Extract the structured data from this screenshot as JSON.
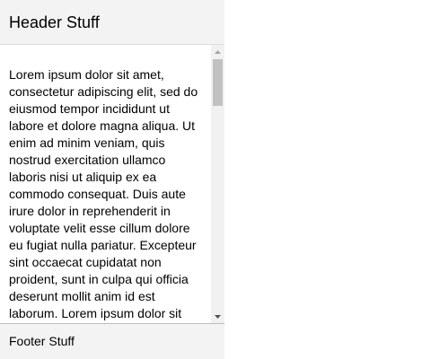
{
  "header": {
    "title": "Header Stuff"
  },
  "content": {
    "text": "Lorem ipsum dolor sit amet, consectetur adipiscing elit, sed do eiusmod tempor incididunt ut labore et dolore magna aliqua. Ut enim ad minim veniam, quis nostrud exercitation ullamco laboris nisi ut aliquip ex ea commodo consequat. Duis aute irure dolor in reprehenderit in voluptate velit esse cillum dolore eu fugiat nulla pariatur. Excepteur sint occaecat cupidatat non proident, sunt in culpa qui officia deserunt mollit anim id est laborum. Lorem ipsum dolor sit"
  },
  "scrollbar": {
    "up_icon": "scroll-up-arrow-icon",
    "down_icon": "scroll-down-arrow-icon",
    "position": 0
  },
  "footer": {
    "title": "Footer Stuff"
  },
  "colors": {
    "header_bg": "#f3f3f3",
    "footer_bg": "#f3f3f3",
    "scrollbar_track": "#f1f1f1",
    "scrollbar_thumb": "#c1c1c1"
  }
}
